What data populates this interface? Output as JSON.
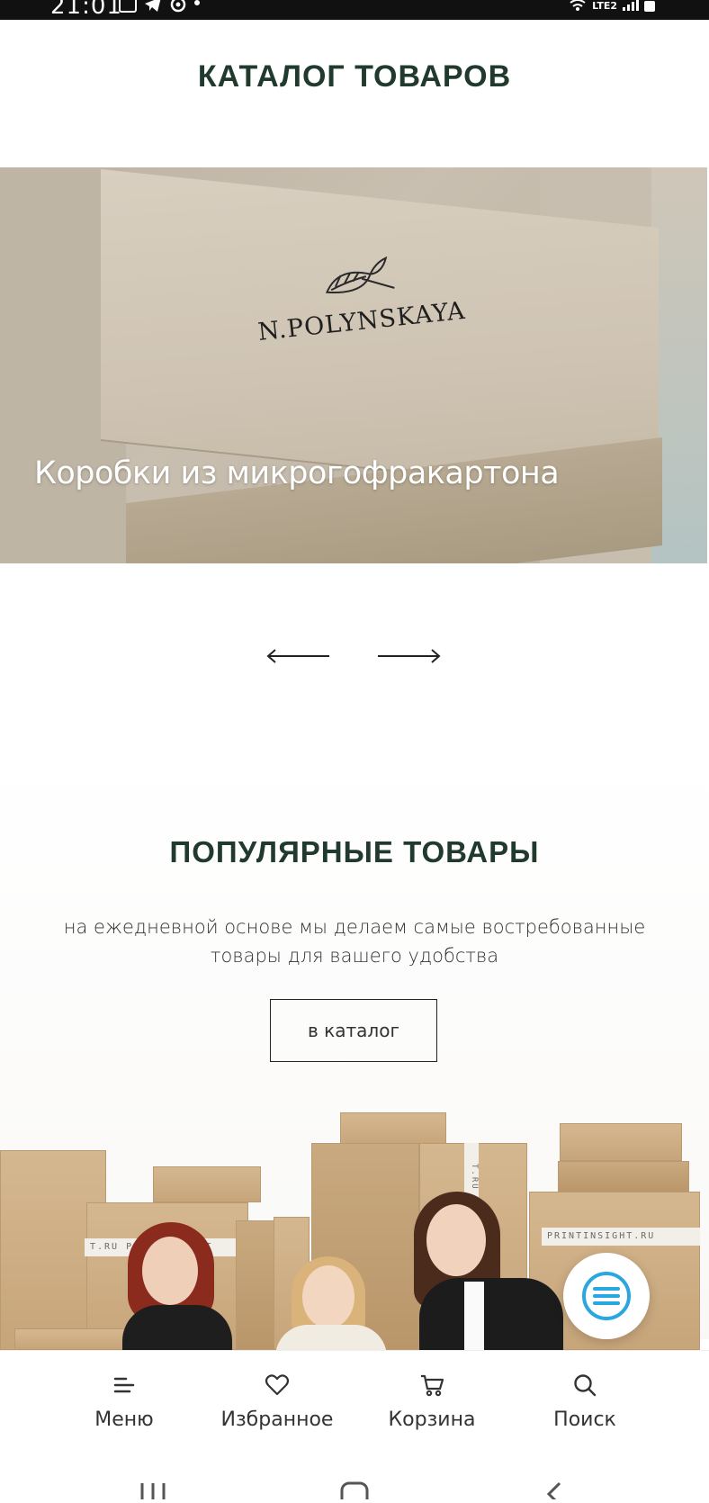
{
  "status_bar": {
    "time": "21:01",
    "network": "LTE2",
    "icons": [
      "gallery-icon",
      "telegram-icon",
      "app-icon",
      "dot-icon",
      "wifi-icon",
      "signal-icon",
      "battery-icon"
    ]
  },
  "header": {
    "title": "КАТАЛОГ ТОВАРОВ"
  },
  "slider": {
    "brand_text": "N.POLYNSKAYA",
    "caption": "Коробки из микрогофракартона",
    "prev_icon": "arrow-left-icon",
    "next_icon": "arrow-right-icon"
  },
  "popular": {
    "title": "ПОПУЛЯРНЫЕ ТОВАРЫ",
    "subtitle": "на ежедневной основе мы делаем самые востребованные товары для вашего удобства",
    "button_label": "в каталог"
  },
  "hero": {
    "tape_text": "PRINTINSIGHT.RU",
    "tape_text_left": "T.RU PRINTINSIGHT",
    "tape_text_vertical": "T.RU PRINT"
  },
  "chat": {
    "icon": "chat-menu-icon",
    "color": "#2aa7e0"
  },
  "bottom_nav": {
    "items": [
      {
        "label": "Меню",
        "icon": "menu-icon"
      },
      {
        "label": "Избранное",
        "icon": "heart-icon"
      },
      {
        "label": "Корзина",
        "icon": "cart-icon"
      },
      {
        "label": "Поиск",
        "icon": "search-icon"
      }
    ]
  },
  "colors": {
    "heading": "#213a2e",
    "accent": "#2aa7e0",
    "text": "#333333"
  }
}
